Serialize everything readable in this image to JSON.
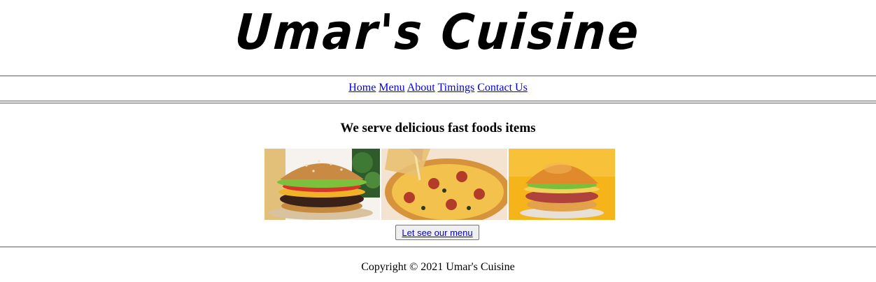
{
  "header": {
    "logo_text": "Umar's Cuisine"
  },
  "nav": {
    "items": [
      {
        "label": "Home"
      },
      {
        "label": "Menu"
      },
      {
        "label": "About"
      },
      {
        "label": "Timings"
      },
      {
        "label": "Contact Us"
      }
    ]
  },
  "main": {
    "tagline": "We serve delicious fast foods items",
    "images": [
      {
        "name": "burger-photo"
      },
      {
        "name": "pizza-photo"
      },
      {
        "name": "burger-photo"
      }
    ],
    "cta_label": "Let see our menu"
  },
  "footer": {
    "copyright": "Copyright © 2021 Umar's Cuisine"
  },
  "colors": {
    "link": "#0000ee",
    "rule": "#808080",
    "button_bg": "#efefef"
  }
}
